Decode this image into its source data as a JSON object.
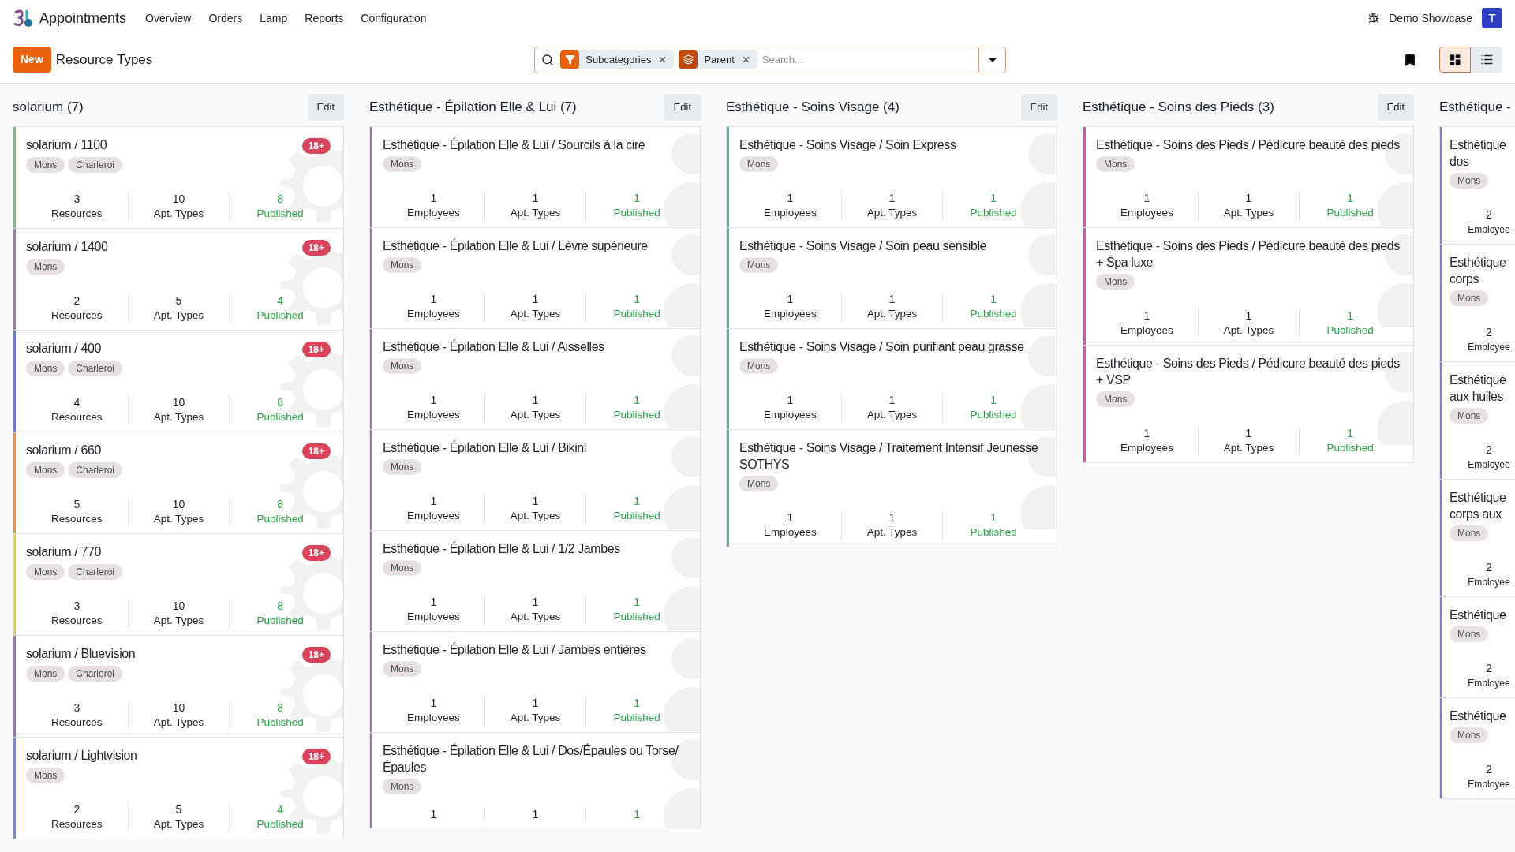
{
  "navbar": {
    "app_name": "Appointments",
    "menu": [
      "Overview",
      "Orders",
      "Lamp",
      "Reports",
      "Configuration"
    ],
    "company": "Demo Showcase",
    "avatar": "T"
  },
  "control_panel": {
    "new_button": "New",
    "breadcrumb": "Resource Types",
    "search": {
      "facets": [
        {
          "kind": "filter",
          "label": "Subcategories"
        },
        {
          "kind": "group",
          "label": "Parent"
        }
      ],
      "placeholder": "Search..."
    },
    "views": [
      {
        "kind": "kanban",
        "selected": true
      },
      {
        "kind": "list",
        "selected": false
      }
    ]
  },
  "columns": [
    {
      "title": "solarium (7)",
      "edit_button": "Edit",
      "kind": "gear",
      "cards": [
        {
          "title": "solarium / 1100",
          "color": "#74c17a",
          "badge": "18+",
          "tags": [
            "Mons",
            "Charleroi"
          ],
          "stats": [
            {
              "value": "3",
              "label": "Resources"
            },
            {
              "value": "10",
              "label": "Apt. Types"
            },
            {
              "value": "8",
              "label": "Published"
            }
          ]
        },
        {
          "title": "solarium / 1400",
          "color": "#a87aa6",
          "badge": "18+",
          "tags": [
            "Mons"
          ],
          "stats": [
            {
              "value": "2",
              "label": "Resources"
            },
            {
              "value": "5",
              "label": "Apt. Types"
            },
            {
              "value": "4",
              "label": "Published"
            }
          ]
        },
        {
          "title": "solarium / 400",
          "color": "#5a7fd6",
          "badge": "18+",
          "tags": [
            "Mons",
            "Charleroi"
          ],
          "stats": [
            {
              "value": "4",
              "label": "Resources"
            },
            {
              "value": "10",
              "label": "Apt. Types"
            },
            {
              "value": "8",
              "label": "Published"
            }
          ]
        },
        {
          "title": "solarium / 660",
          "color": "#e8974a",
          "badge": "18+",
          "tags": [
            "Mons",
            "Charleroi"
          ],
          "stats": [
            {
              "value": "5",
              "label": "Resources"
            },
            {
              "value": "10",
              "label": "Apt. Types"
            },
            {
              "value": "8",
              "label": "Published"
            }
          ]
        },
        {
          "title": "solarium / 770",
          "color": "#f2c94c",
          "badge": "18+",
          "tags": [
            "Mons",
            "Charleroi"
          ],
          "stats": [
            {
              "value": "3",
              "label": "Resources"
            },
            {
              "value": "10",
              "label": "Apt. Types"
            },
            {
              "value": "8",
              "label": "Published"
            }
          ]
        },
        {
          "title": "solarium / Bluevision",
          "color": "#9b6bc8",
          "badge": "18+",
          "tags": [
            "Mons",
            "Charleroi"
          ],
          "stats": [
            {
              "value": "3",
              "label": "Resources"
            },
            {
              "value": "10",
              "label": "Apt. Types"
            },
            {
              "value": "8",
              "label": "Published"
            }
          ]
        },
        {
          "title": "solarium / Lightvision",
          "color": "#6a8fdc",
          "badge": "18+",
          "tags": [
            "Mons"
          ],
          "stats": [
            {
              "value": "2",
              "label": "Resources"
            },
            {
              "value": "5",
              "label": "Apt. Types"
            },
            {
              "value": "4",
              "label": "Published"
            }
          ]
        }
      ]
    },
    {
      "title": "Esthétique - Épilation Elle & Lui (7)",
      "edit_button": "Edit",
      "kind": "person",
      "cards": [
        {
          "title": "Esthétique - Épilation Elle & Lui / Sourcils à la cire",
          "color": "#a8709a",
          "tags": [
            "Mons"
          ],
          "stats": [
            {
              "value": "1",
              "label": "Employees"
            },
            {
              "value": "1",
              "label": "Apt. Types"
            },
            {
              "value": "1",
              "label": "Published"
            }
          ]
        },
        {
          "title": "Esthétique - Épilation Elle & Lui / Lèvre supérieure",
          "color": "#a8709a",
          "tags": [
            "Mons"
          ],
          "stats": [
            {
              "value": "1",
              "label": "Employees"
            },
            {
              "value": "1",
              "label": "Apt. Types"
            },
            {
              "value": "1",
              "label": "Published"
            }
          ]
        },
        {
          "title": "Esthétique - Épilation Elle & Lui / Aisselles",
          "color": "#a8709a",
          "tags": [
            "Mons"
          ],
          "stats": [
            {
              "value": "1",
              "label": "Employees"
            },
            {
              "value": "1",
              "label": "Apt. Types"
            },
            {
              "value": "1",
              "label": "Published"
            }
          ]
        },
        {
          "title": "Esthétique - Épilation Elle & Lui / Bikini",
          "color": "#a8709a",
          "tags": [
            "Mons"
          ],
          "stats": [
            {
              "value": "1",
              "label": "Employees"
            },
            {
              "value": "1",
              "label": "Apt. Types"
            },
            {
              "value": "1",
              "label": "Published"
            }
          ]
        },
        {
          "title": "Esthétique - Épilation Elle & Lui / 1/2 Jambes",
          "color": "#a8709a",
          "tags": [
            "Mons"
          ],
          "stats": [
            {
              "value": "1",
              "label": "Employees"
            },
            {
              "value": "1",
              "label": "Apt. Types"
            },
            {
              "value": "1",
              "label": "Published"
            }
          ]
        },
        {
          "title": "Esthétique - Épilation Elle & Lui / Jambes entières",
          "color": "#a8709a",
          "tags": [
            "Mons"
          ],
          "stats": [
            {
              "value": "1",
              "label": "Employees"
            },
            {
              "value": "1",
              "label": "Apt. Types"
            },
            {
              "value": "1",
              "label": "Published"
            }
          ]
        },
        {
          "title": "Esthétique - Épilation Elle & Lui / Dos/Épaules ou Torse/Épaules",
          "color": "#a8709a",
          "tags": [
            "Mons"
          ],
          "stats": [
            {
              "value": "1"
            },
            {
              "value": "1"
            },
            {
              "value": "1"
            }
          ]
        }
      ]
    },
    {
      "title": "Esthétique - Soins Visage (4)",
      "edit_button": "Edit",
      "kind": "person",
      "cards": [
        {
          "title": "Esthétique - Soins Visage / Soin Express",
          "color": "#6aa5ab",
          "tags": [
            "Mons"
          ],
          "stats": [
            {
              "value": "1",
              "label": "Employees"
            },
            {
              "value": "1",
              "label": "Apt. Types"
            },
            {
              "value": "1",
              "label": "Published"
            }
          ]
        },
        {
          "title": "Esthétique - Soins Visage / Soin peau sensible",
          "color": "#6aa5ab",
          "tags": [
            "Mons"
          ],
          "stats": [
            {
              "value": "1",
              "label": "Employees"
            },
            {
              "value": "1",
              "label": "Apt. Types"
            },
            {
              "value": "1",
              "label": "Published"
            }
          ]
        },
        {
          "title": "Esthétique - Soins Visage / Soin purifiant peau grasse",
          "color": "#6aa5ab",
          "tags": [
            "Mons"
          ],
          "stats": [
            {
              "value": "1",
              "label": "Employees"
            },
            {
              "value": "1",
              "label": "Apt. Types"
            },
            {
              "value": "1",
              "label": "Published"
            }
          ]
        },
        {
          "title": "Esthétique - Soins Visage / Traitement Intensif Jeunesse SOTHYS",
          "color": "#6aa5ab",
          "tags": [
            "Mons"
          ],
          "stats": [
            {
              "value": "1",
              "label": "Employees"
            },
            {
              "value": "1",
              "label": "Apt. Types"
            },
            {
              "value": "1",
              "label": "Published"
            }
          ]
        }
      ]
    },
    {
      "title": "Esthétique - Soins des Pieds (3)",
      "edit_button": "Edit",
      "kind": "person",
      "cards": [
        {
          "title": "Esthétique - Soins des Pieds / Pédicure beauté des pieds",
          "color": "#d8569e",
          "tags": [
            "Mons"
          ],
          "stats": [
            {
              "value": "1",
              "label": "Employees"
            },
            {
              "value": "1",
              "label": "Apt. Types"
            },
            {
              "value": "1",
              "label": "Published"
            }
          ]
        },
        {
          "title": "Esthétique - Soins des Pieds / Pédicure beauté des pieds + Spa luxe",
          "color": "#d8569e",
          "tags": [
            "Mons"
          ],
          "stats": [
            {
              "value": "1",
              "label": "Employees"
            },
            {
              "value": "1",
              "label": "Apt. Types"
            },
            {
              "value": "1",
              "label": "Published"
            }
          ]
        },
        {
          "title": "Esthétique - Soins des Pieds / Pédicure beauté des pieds + VSP",
          "color": "#d8569e",
          "tags": [
            "Mons"
          ],
          "stats": [
            {
              "value": "1",
              "label": "Employees"
            },
            {
              "value": "1",
              "label": "Apt. Types"
            },
            {
              "value": "1",
              "label": "Published"
            }
          ]
        }
      ]
    },
    {
      "title": "Esthétique -",
      "kind": "person",
      "cards": [
        {
          "title_lines": [
            "Esthétique",
            "dos"
          ],
          "color": "#8f74d8",
          "tags": [
            "Mons"
          ],
          "stats": [
            {
              "value": "2",
              "label": "Employee"
            }
          ]
        },
        {
          "title_lines": [
            "Esthétique",
            "corps"
          ],
          "color": "#8f74d8",
          "tags": [
            "Mons"
          ],
          "stats": [
            {
              "value": "2",
              "label": "Employee"
            }
          ]
        },
        {
          "title_lines": [
            "Esthétique",
            "aux huiles"
          ],
          "color": "#8f74d8",
          "tags": [
            "Mons"
          ],
          "stats": [
            {
              "value": "2",
              "label": "Employee"
            }
          ]
        },
        {
          "title_lines": [
            "Esthétique",
            "corps aux"
          ],
          "color": "#8f74d8",
          "tags": [
            "Mons"
          ],
          "stats": [
            {
              "value": "2",
              "label": "Employee"
            }
          ]
        },
        {
          "title_lines": [
            "Esthétique"
          ],
          "color": "#8f74d8",
          "tags": [
            "Mons"
          ],
          "stats": [
            {
              "value": "2",
              "label": "Employee"
            }
          ]
        },
        {
          "title_lines": [
            "Esthétique"
          ],
          "color": "#8f74d8",
          "tags": [
            "Mons"
          ],
          "stats": [
            {
              "value": "2",
              "label": "Employee"
            }
          ]
        }
      ]
    }
  ]
}
